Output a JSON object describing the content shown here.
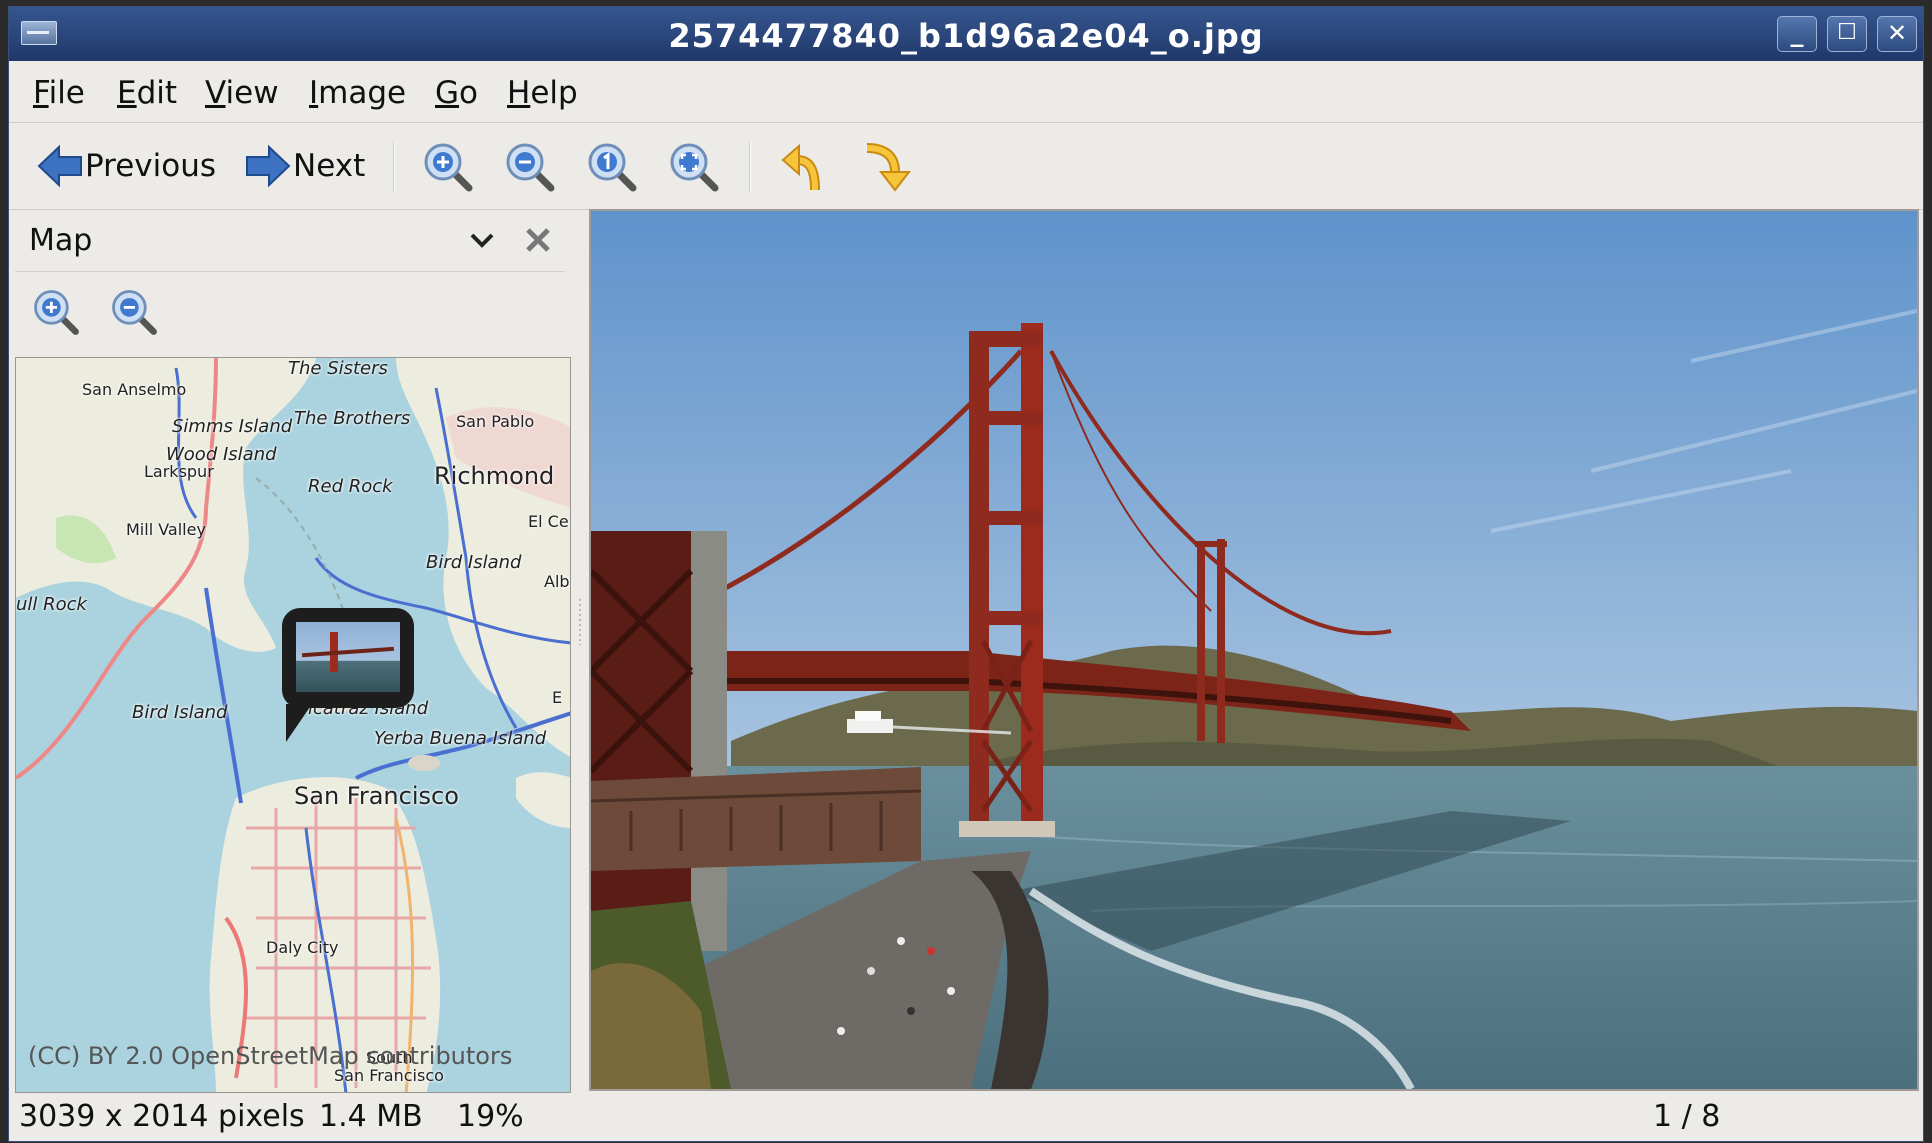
{
  "window": {
    "title": "2574477840_b1d96a2e04_o.jpg",
    "controls": {
      "minimize": "_",
      "maximize": "☐",
      "close": "✕"
    }
  },
  "menubar": {
    "items": [
      {
        "label": "File",
        "mnemonic": "F",
        "rest": "ile"
      },
      {
        "label": "Edit",
        "mnemonic": "E",
        "rest": "dit"
      },
      {
        "label": "View",
        "mnemonic": "V",
        "rest": "iew"
      },
      {
        "label": "Image",
        "mnemonic": "I",
        "rest": "mage"
      },
      {
        "label": "Go",
        "mnemonic": "G",
        "rest": "o"
      },
      {
        "label": "Help",
        "mnemonic": "H",
        "rest": "elp"
      }
    ]
  },
  "toolbar": {
    "previous_label": "Previous",
    "next_label": "Next",
    "icons": [
      "zoom-in-icon",
      "zoom-out-icon",
      "zoom-normal-icon",
      "zoom-fit-icon",
      "rotate-left-icon",
      "rotate-right-icon"
    ]
  },
  "sidebar": {
    "title": "Map",
    "map": {
      "labels": {
        "sisters": "The Sisters",
        "san_anselmo": "San Anselmo",
        "simms": "Simms Island",
        "brothers": "The Brothers",
        "san_pablo": "San Pablo",
        "wood": "Wood Island",
        "larkspur": "Larkspur",
        "red_rock": "Red Rock",
        "richmond": "Richmond",
        "el_ce": "El Ce",
        "mill_valley": "Mill Valley",
        "bird_island_e": "Bird Island",
        "alb": "Alb",
        "bull_rock": "ull Rock",
        "bird_island_w": "Bird Island",
        "alcatraz": "lcatraz Island",
        "e": "E",
        "yerba": "Yerba Buena Island",
        "san_francisco": "San Francisco",
        "daly_city": "Daly City",
        "south": "South",
        "south_sf": "San Francisco"
      },
      "attribution": "(CC) BY 2.0 OpenStreetMap contributors"
    }
  },
  "status": {
    "dimensions": "3039 x 2014 pixels",
    "size": "1.4 MB",
    "zoom": "19%",
    "position": "1 / 8"
  },
  "colors": {
    "titlebar": "#2a4478",
    "water": "#aad3df",
    "bridge": "#9c2a1d",
    "sky": "#6d9ccd"
  }
}
